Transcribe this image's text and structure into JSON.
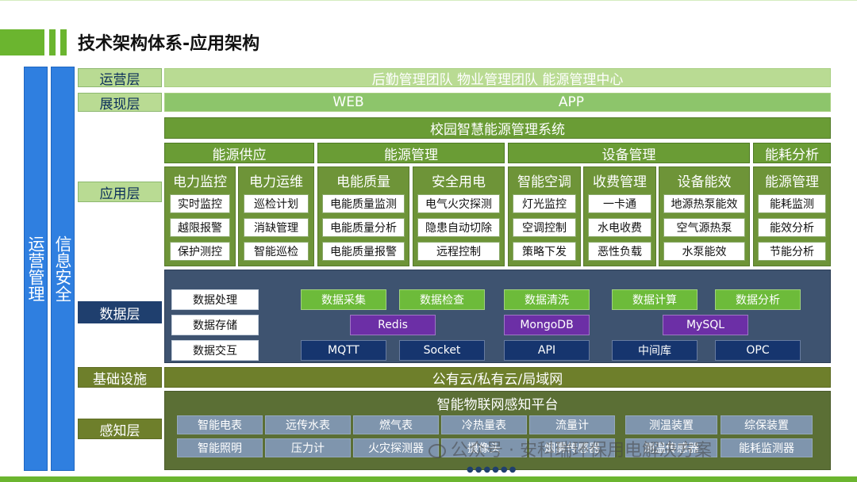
{
  "title": "技术架构体系-应用架构",
  "side_columns": {
    "ops_management": "运营管理",
    "info_security": "信息安全"
  },
  "layers": {
    "ops": "运营层",
    "display": "展现层",
    "app": "应用层",
    "data": "数据层",
    "infra": "基础设施",
    "sense": "感知层"
  },
  "ops_bar": "后勤管理团队   物业管理团队   能源管理中心",
  "display_bar": {
    "web": "WEB",
    "app": "APP"
  },
  "system_bar": "校园智慧能源管理系统",
  "groups": {
    "supply": {
      "title": "能源供应",
      "sub1": {
        "title": "电力监控",
        "items": [
          "实时监控",
          "越限报警",
          "保护测控"
        ]
      },
      "sub2": {
        "title": "电力运维",
        "items": [
          "巡检计划",
          "消缺管理",
          "智能巡检"
        ]
      }
    },
    "energy": {
      "title": "能源管理",
      "sub1": {
        "title": "电能质量",
        "items": [
          "电能质量监测",
          "电能质量分析",
          "电能质量报警"
        ]
      },
      "sub2": {
        "title": "安全用电",
        "items": [
          "电气火灾探测",
          "隐患自动切除",
          "远程控制"
        ]
      }
    },
    "device": {
      "title": "设备管理",
      "sub1": {
        "title": "智能空调",
        "items": [
          "灯光监控",
          "空调控制",
          "策略下发"
        ]
      },
      "sub2": {
        "title": "收费管理",
        "items": [
          "一卡通",
          "水电收费",
          "恶性负载"
        ]
      },
      "sub3": {
        "title": "设备能效",
        "items": [
          "地源热泵能效",
          "空气源热泵",
          "水泵能效"
        ]
      }
    },
    "analysis": {
      "title": "能耗分析",
      "sub1": {
        "title": "能源管理",
        "items": [
          "能耗监测",
          "能效分析",
          "节能分析"
        ]
      }
    }
  },
  "data_layer": {
    "left": [
      "数据处理",
      "数据存储",
      "数据交互"
    ],
    "row1": [
      "数据采集",
      "数据检查",
      "数据清洗",
      "数据计算",
      "数据分析"
    ],
    "row2": [
      "Redis",
      "MongoDB",
      "MySQL"
    ],
    "row3": [
      "MQTT",
      "Socket",
      "API",
      "中间库",
      "OPC"
    ],
    "colors": {
      "green": "#6dbb3a",
      "purple": "#6c2fa6",
      "navy": "#16356e"
    }
  },
  "infra_bar": "公有云/私有云/局域网",
  "sense": {
    "platform": "智能物联网感知平台",
    "row1": [
      "智能电表",
      "远传水表",
      "燃气表",
      "冷热量表",
      "流量计",
      "测温装置",
      "综保装置"
    ],
    "row2": [
      "智能照明",
      "压力计",
      "火灾探测器",
      "摄像头",
      "烟雾传感器",
      "测温传感器",
      "能耗监测器"
    ]
  },
  "watermark": "公众号 · 安科瑞环保用电解决方案",
  "colors": {
    "accent_green": "#6bb52f",
    "accent_blue": "#2f7fe0"
  }
}
